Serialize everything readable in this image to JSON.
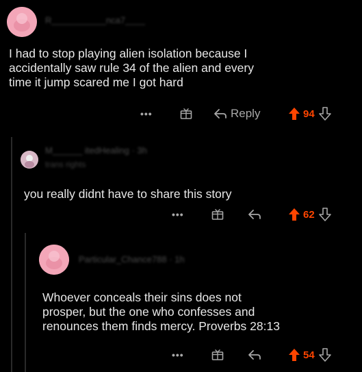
{
  "comments": [
    {
      "username": "R___________nca7____",
      "body": "I had to stop playing alien isolation because I\naccidentally saw rule 34 of the alien and every\ntime it jump scared me I got hard",
      "more": "•••",
      "reply_label": "Reply",
      "votes": "94"
    },
    {
      "username": "M______ itedHealing · 3h",
      "flair": "trans rights",
      "body": "you really didnt have to share this story",
      "more": "•••",
      "votes": "62"
    },
    {
      "username": "Particular_Chance7​88 · 1h",
      "body": "Whoever conceals their sins does not\nprosper, but the one who confesses and\nrenounces them finds mercy. Proverbs 28:13",
      "more": "•••",
      "votes": "54"
    }
  ],
  "colors": {
    "background": "#000000",
    "upvote": "#ff4500",
    "avatar_pink": "#f3a6b8",
    "text": "#e8e8e8",
    "muted": "#a0a0a0"
  },
  "icons": [
    "snoo-avatar-icon",
    "award-icon",
    "reply-arrow-icon",
    "upvote-arrow-icon",
    "downvote-arrow-icon"
  ]
}
